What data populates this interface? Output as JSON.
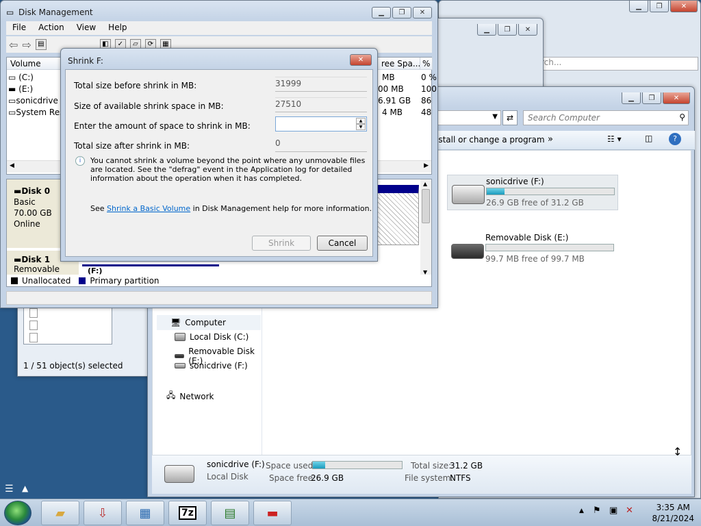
{
  "diskmgmt": {
    "title": "Disk Management",
    "menu": [
      "File",
      "Action",
      "View",
      "Help"
    ],
    "columns": {
      "volume": "Volume",
      "free_space": "ree Spa...",
      "pct_free": "% F"
    },
    "volumes": [
      {
        "name": "(C:)",
        "free": "MB",
        "pct": "0 %"
      },
      {
        "name": "(E:)",
        "free": "00 MB",
        "pct": "100"
      },
      {
        "name": "sonicdrive",
        "free": "6.91 GB",
        "pct": "86"
      },
      {
        "name": "System Res",
        "free": "4 MB",
        "pct": "48"
      }
    ],
    "disk0": {
      "name": "Disk 0",
      "type": "Basic",
      "size": "70.00 GB",
      "status": "Online"
    },
    "disk1": {
      "name": "Disk 1",
      "type": "Removable",
      "part_label": "(F:)"
    },
    "legend": {
      "unallocated": "Unallocated",
      "primary": "Primary partition"
    },
    "colors": {
      "unallocated": "#000000",
      "primary": "#00008b"
    }
  },
  "shrink_dialog": {
    "title": "Shrink F:",
    "rows": [
      {
        "label": "Total size before shrink in MB:",
        "value": "31999"
      },
      {
        "label": "Size of available shrink space in MB:",
        "value": "27510"
      },
      {
        "label": "Enter the amount of space to shrink in MB:",
        "value": ""
      },
      {
        "label": "Total size after shrink in MB:",
        "value": "0"
      }
    ],
    "info_text": "You cannot shrink a volume beyond the point where any unmovable files are located. See the \"defrag\" event in the Application log for detailed information about the operation when it has completed.",
    "see_prefix": "See ",
    "see_link": "Shrink a Basic Volume",
    "see_suffix": " in Disk Management help for more information.",
    "shrink_label": "Shrink",
    "cancel_label": "Cancel"
  },
  "explorer": {
    "search_placeholder": "Search Computer",
    "cmd_uninstall": "ıstall or change a program",
    "cmd_more": "»",
    "drives": [
      {
        "name": "sonicdrive (F:)",
        "free_text": "26.9 GB free of 31.2 GB",
        "used_fraction": 0.14
      },
      {
        "name": "Removable Disk (E:)",
        "free_text": "99.7 MB free of 99.7 MB",
        "used_fraction": 0.0
      }
    ],
    "nav": {
      "computer": "Computer",
      "local_c": "Local Disk (C:)",
      "removable_e": "Removable Disk (E:)",
      "sonic_f": "sonicdrive (F:)",
      "network": "Network"
    },
    "details": {
      "name": "sonicdrive (F:)",
      "type": "Local Disk",
      "space_used_label": "Space used:",
      "space_free_label": "Space free:",
      "space_free": "26.9 GB",
      "total_size_label": "Total size:",
      "total_size": "31.2 GB",
      "fs_label": "File system:",
      "fs": "NTFS",
      "used_fraction": 0.14
    }
  },
  "bg_window": {
    "status": "1 / 51 object(s) selected",
    "search_hint": "rch..."
  },
  "taskbar": {
    "time": "3:35 AM",
    "date": "8/21/2024",
    "apps": [
      "folder-icon",
      "installer-icon",
      "control-panel-icon",
      "7zip-icon",
      "network-card-icon",
      "toolbox-icon"
    ],
    "sevenzip_label": "7z"
  }
}
